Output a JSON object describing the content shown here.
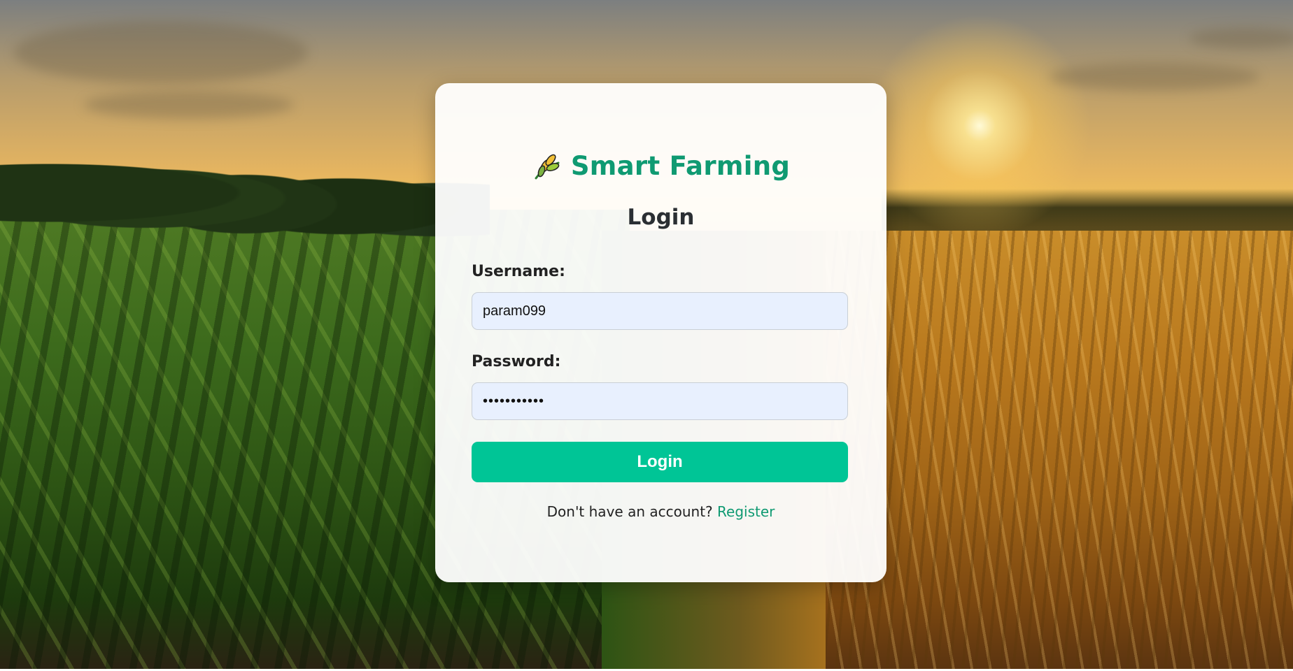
{
  "app": {
    "brand_title": "Smart Farming",
    "brand_icon": "wheat-icon",
    "accent_color": "#0f9a72",
    "button_color": "#00c596"
  },
  "login": {
    "heading": "Login",
    "username_label": "Username:",
    "username_value": "param099",
    "password_label": "Password:",
    "password_value": "•••••••••••",
    "submit_label": "Login",
    "register_prompt": "Don't have an account?",
    "register_link": "Register"
  }
}
